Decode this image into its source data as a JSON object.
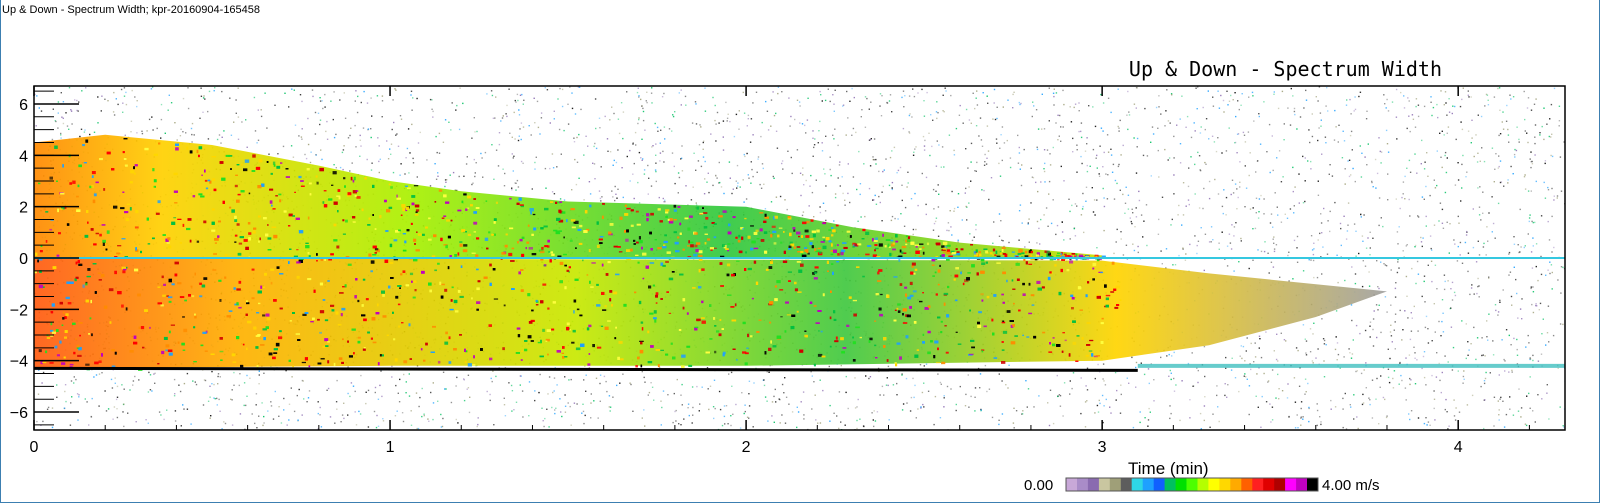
{
  "window": {
    "title": "Up & Down - Spectrum Width; kpr-20160904-165458"
  },
  "chart_data": {
    "type": "heatmap",
    "title": "Up & Down - Spectrum Width",
    "xlabel": "Time (min)",
    "ylabel": "",
    "xlim": [
      0,
      4.3
    ],
    "ylim": [
      -6.7,
      6.7
    ],
    "x_ticks": [
      0,
      1,
      2,
      3,
      4
    ],
    "y_ticks": [
      6,
      4,
      2,
      0,
      -2,
      -4,
      -6
    ],
    "y_tick_labels": [
      "6",
      "4",
      "2",
      "0",
      "−2",
      "−4",
      "−6"
    ],
    "colorbar": {
      "min_label": "0.00",
      "max_label": "4.00 m/s",
      "min": 0.0,
      "max": 4.0,
      "colors": [
        "#c8a8d8",
        "#a98cc8",
        "#8a6bb0",
        "#c9c6a0",
        "#9f9f78",
        "#5d5d5d",
        "#2ed6e6",
        "#1ea0ff",
        "#1060ff",
        "#00c060",
        "#00e000",
        "#4cff00",
        "#b4ff00",
        "#ffff00",
        "#ffd800",
        "#ffaa00",
        "#ff6000",
        "#ff2020",
        "#e00000",
        "#b00000",
        "#ff00ff",
        "#c000c0",
        "#000000"
      ]
    },
    "features": {
      "upper_echo_top": [
        [
          0,
          4.5
        ],
        [
          0.2,
          4.8
        ],
        [
          0.5,
          4.4
        ],
        [
          0.8,
          3.6
        ],
        [
          1.0,
          3.0
        ],
        [
          1.2,
          2.6
        ],
        [
          1.5,
          2.2
        ],
        [
          2.0,
          2.0
        ],
        [
          2.3,
          1.2
        ],
        [
          2.6,
          0.6
        ],
        [
          3.0,
          0.1
        ]
      ],
      "lower_echo_edge": [
        [
          0,
          -4.3
        ],
        [
          1.0,
          -4.2
        ],
        [
          2.0,
          -4.2
        ],
        [
          3.0,
          -4.0
        ],
        [
          3.3,
          -3.4
        ],
        [
          3.6,
          -2.3
        ],
        [
          3.8,
          -1.3
        ],
        [
          3.3,
          -0.6
        ],
        [
          3.0,
          -0.1
        ]
      ],
      "zero_line_y": 0,
      "surface_line_y": -4.3
    }
  }
}
